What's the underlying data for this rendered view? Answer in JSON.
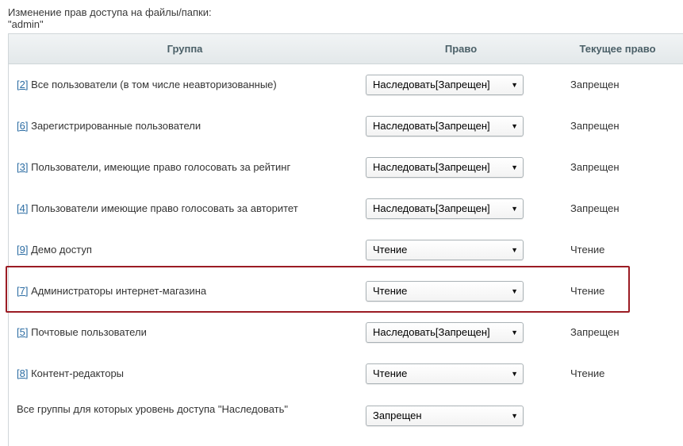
{
  "heading": {
    "line1": "Изменение прав доступа на файлы/папки:",
    "line2": "\"admin\""
  },
  "table": {
    "headers": {
      "group": "Группа",
      "right": "Право",
      "current": "Текущее право"
    },
    "rows": [
      {
        "id": "[2]",
        "name": "Все пользователи (в том числе неавторизованные)",
        "right": "Наследовать[Запрещен]",
        "current": "Запрещен"
      },
      {
        "id": "[6]",
        "name": "Зарегистрированные пользователи",
        "right": "Наследовать[Запрещен]",
        "current": "Запрещен"
      },
      {
        "id": "[3]",
        "name": "Пользователи, имеющие право голосовать за рейтинг",
        "right": "Наследовать[Запрещен]",
        "current": "Запрещен"
      },
      {
        "id": "[4]",
        "name": "Пользователи имеющие право голосовать за авторитет",
        "right": "Наследовать[Запрещен]",
        "current": "Запрещен"
      },
      {
        "id": "[9]",
        "name": "Демо доступ",
        "right": "Чтение",
        "current": "Чтение"
      },
      {
        "id": "[7]",
        "name": "Администраторы интернет-магазина",
        "right": "Чтение",
        "current": "Чтение"
      },
      {
        "id": "[5]",
        "name": "Почтовые пользователи",
        "right": "Наследовать[Запрещен]",
        "current": "Запрещен"
      },
      {
        "id": "[8]",
        "name": "Контент-редакторы",
        "right": "Чтение",
        "current": "Чтение"
      }
    ],
    "inherit_row": {
      "label": "Все группы для которых уровень доступа \"Наследовать\"",
      "right": "Запрещен"
    }
  },
  "icons": {
    "dropdown": "chevron-down-icon"
  },
  "colors": {
    "highlight": "#9b1c24",
    "link": "#2d6da3"
  }
}
